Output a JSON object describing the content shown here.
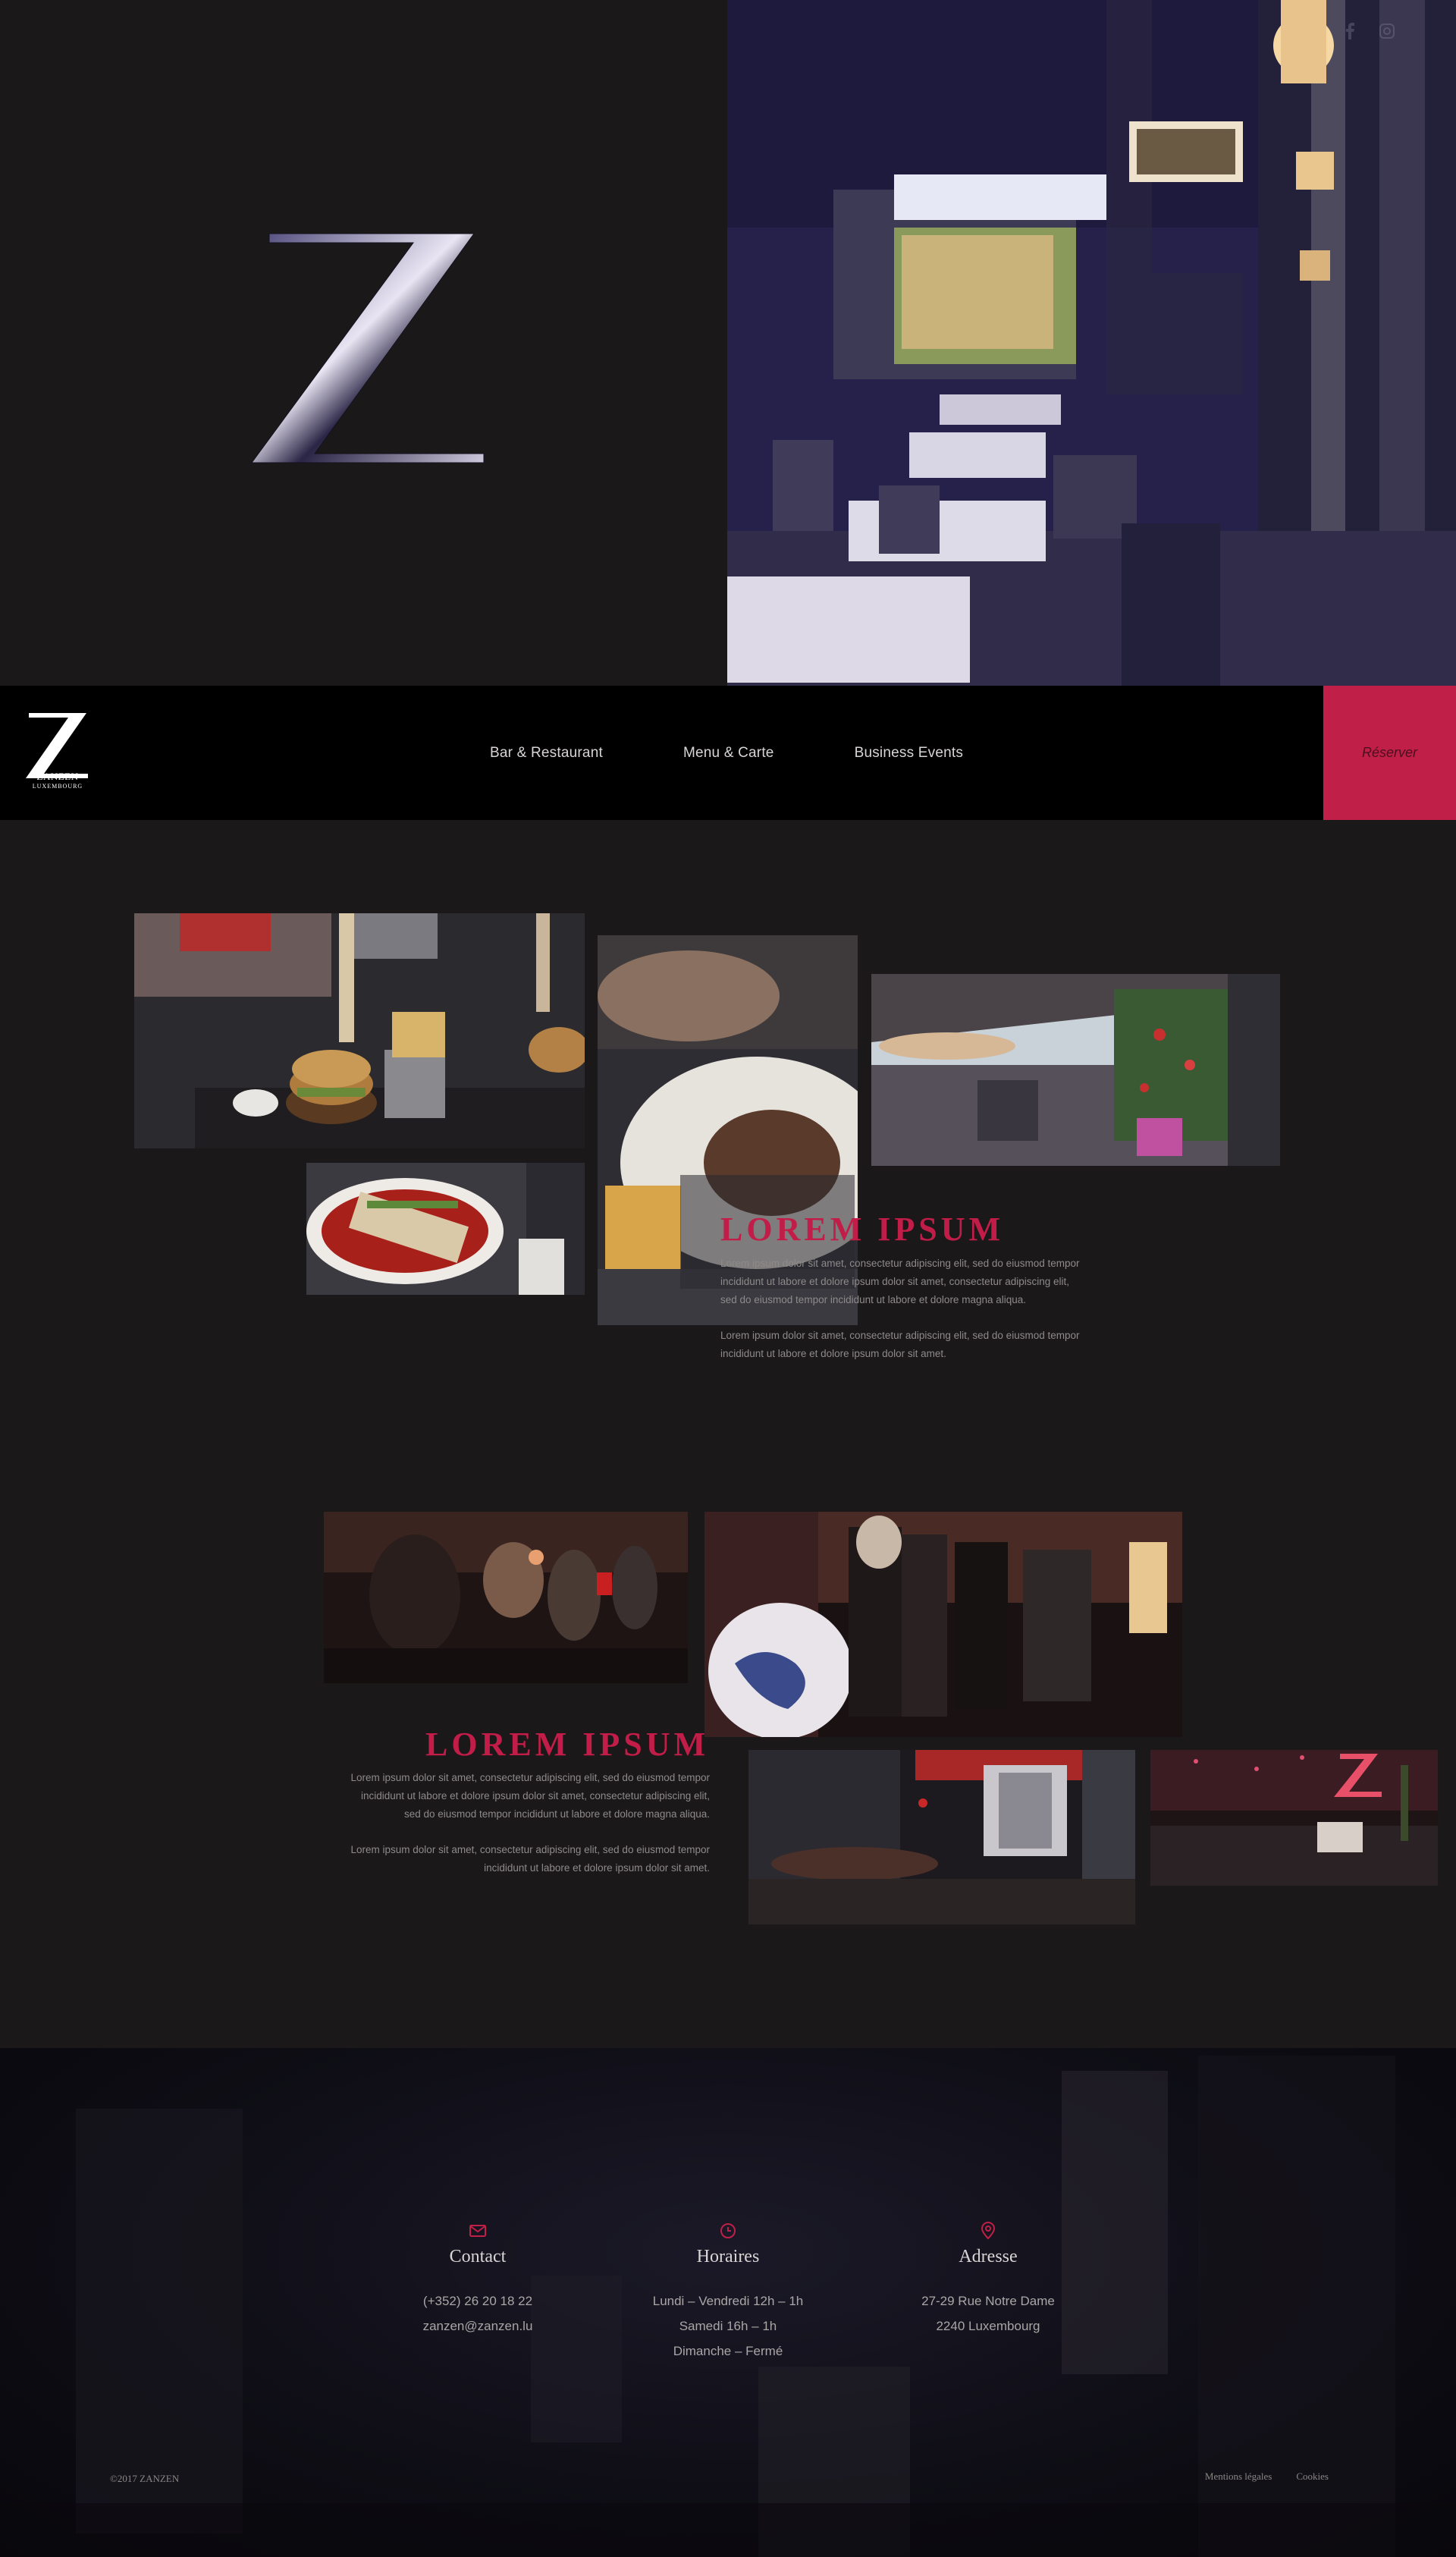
{
  "brand": {
    "name": "ZANZEN",
    "subtitle": "LUXEMBOURG",
    "accent_color": "#c01f47"
  },
  "hero": {
    "logo_letter": "Z",
    "social_icons": [
      "facebook-icon",
      "instagram-icon"
    ]
  },
  "nav": {
    "items": [
      {
        "label": "Bar & Restaurant"
      },
      {
        "label": "Menu & Carte"
      },
      {
        "label": "Business Events"
      }
    ],
    "reserve_label": "Réserver"
  },
  "section1": {
    "title": "LOREM IPSUM",
    "paragraphs": [
      "Lorem ipsum dolor sit amet, consectetur adipiscing elit, sed do eiusmod tempor incididunt ut labore et dolore  ipsum dolor sit amet, consectetur adipiscing elit, sed do eiusmod tempor incididunt ut labore et dolore magna aliqua.",
      "Lorem ipsum dolor sit amet, consectetur adipiscing elit, sed do eiusmod tempor incididunt ut labore et dolore  ipsum dolor sit amet."
    ]
  },
  "section2": {
    "title": "LOREM IPSUM",
    "paragraphs": [
      "Lorem ipsum dolor sit amet, consectetur adipiscing elit, sed do eiusmod tempor incididunt ut labore et dolore  ipsum dolor sit amet, consectetur adipiscing elit, sed do eiusmod tempor incididunt ut labore et dolore magna aliqua.",
      "Lorem ipsum dolor sit amet, consectetur adipiscing elit, sed do eiusmod tempor incididunt ut labore et dolore  ipsum dolor sit amet."
    ]
  },
  "footer": {
    "contact": {
      "title": "Contact",
      "icon": "mail-icon",
      "phone": "(+352) 26 20 18 22",
      "email": "zanzen@zanzen.lu"
    },
    "hours": {
      "title": "Horaires",
      "icon": "clock-icon",
      "line1": "Lundi – Vendredi 12h  – 1h",
      "line2": "Samedi 16h – 1h",
      "line3": "Dimanche – Fermé"
    },
    "address": {
      "title": "Adresse",
      "icon": "map-pin-icon",
      "line1": "27-29 Rue Notre Dame",
      "line2": "2240 Luxembourg"
    },
    "copyright": "©2017 ZANZEN",
    "legal": [
      "Mentions légales",
      "Cookies"
    ]
  }
}
